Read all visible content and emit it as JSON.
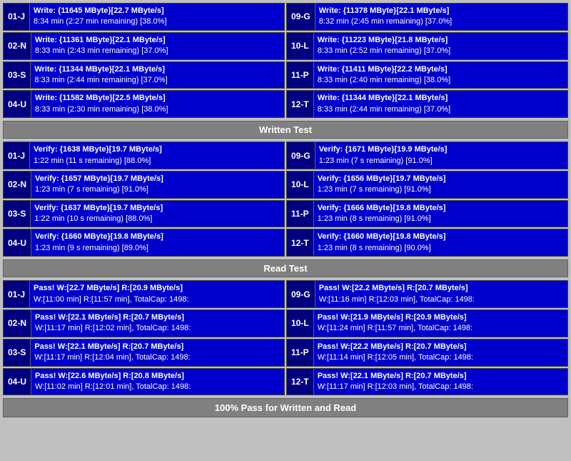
{
  "colors": {
    "bg": "#c0c0c0",
    "cell_bg": "#0000cd",
    "id_bg": "#000080",
    "header_bg": "#808080",
    "text_white": "#ffffff"
  },
  "written_test": {
    "header": "Written Test",
    "cells_left": [
      {
        "id": "01-J",
        "line1": "Write: {11645 MByte}[22.7 MByte/s]",
        "line2": "8:34 min (2:27 min remaining)  [38.0%]"
      },
      {
        "id": "02-N",
        "line1": "Write: {11361 MByte}[22.1 MByte/s]",
        "line2": "8:33 min (2:43 min remaining)  [37.0%]"
      },
      {
        "id": "03-S",
        "line1": "Write: {11344 MByte}[22.1 MByte/s]",
        "line2": "8:33 min (2:44 min remaining)  [37.0%]"
      },
      {
        "id": "04-U",
        "line1": "Write: {11582 MByte}[22.5 MByte/s]",
        "line2": "8:33 min (2:30 min remaining)  [38.0%]"
      }
    ],
    "cells_right": [
      {
        "id": "09-G",
        "line1": "Write: {11378 MByte}[22.1 MByte/s]",
        "line2": "8:32 min (2:45 min remaining)  [37.0%]"
      },
      {
        "id": "10-L",
        "line1": "Write: {11223 MByte}[21.8 MByte/s]",
        "line2": "8:33 min (2:52 min remaining)  [37.0%]"
      },
      {
        "id": "11-P",
        "line1": "Write: {11411 MByte}[22.2 MByte/s]",
        "line2": "8:33 min (2:40 min remaining)  [38.0%]"
      },
      {
        "id": "12-T",
        "line1": "Write: {11344 MByte}[22.1 MByte/s]",
        "line2": "8:33 min (2:44 min remaining)  [37.0%]"
      }
    ]
  },
  "verify_test": {
    "header": "Written Test",
    "cells_left": [
      {
        "id": "01-J",
        "line1": "Verify: {1638 MByte}[19.7 MByte/s]",
        "line2": "1:22 min (11 s remaining)   [88.0%]"
      },
      {
        "id": "02-N",
        "line1": "Verify: {1657 MByte}[19.7 MByte/s]",
        "line2": "1:23 min (7 s remaining)   [91.0%]"
      },
      {
        "id": "03-S",
        "line1": "Verify: {1637 MByte}[19.7 MByte/s]",
        "line2": "1:22 min (10 s remaining)   [88.0%]"
      },
      {
        "id": "04-U",
        "line1": "Verify: {1660 MByte}[19.8 MByte/s]",
        "line2": "1:23 min (9 s remaining)   [89.0%]"
      }
    ],
    "cells_right": [
      {
        "id": "09-G",
        "line1": "Verify: {1671 MByte}[19.9 MByte/s]",
        "line2": "1:23 min (7 s remaining)   [91.0%]"
      },
      {
        "id": "10-L",
        "line1": "Verify: {1656 MByte}[19.7 MByte/s]",
        "line2": "1:23 min (7 s remaining)   [91.0%]"
      },
      {
        "id": "11-P",
        "line1": "Verify: {1666 MByte}[19.8 MByte/s]",
        "line2": "1:23 min (8 s remaining)   [91.0%]"
      },
      {
        "id": "12-T",
        "line1": "Verify: {1660 MByte}[19.8 MByte/s]",
        "line2": "1:23 min (8 s remaining)   [90.0%]"
      }
    ]
  },
  "read_test": {
    "header": "Read Test",
    "cells_left": [
      {
        "id": "01-J",
        "line1": "Pass! W:[22.7 MByte/s] R:[20.9 MByte/s]",
        "line2": " W:[11:00 min] R:[11:57 min], TotalCap: 1498:"
      },
      {
        "id": "02-N",
        "line1": "Pass! W:[22.1 MByte/s] R:[20.7 MByte/s]",
        "line2": " W:[11:17 min] R:[12:02 min], TotalCap: 1498:"
      },
      {
        "id": "03-S",
        "line1": "Pass! W:[22.1 MByte/s] R:[20.7 MByte/s]",
        "line2": " W:[11:17 min] R:[12:04 min], TotalCap: 1498:"
      },
      {
        "id": "04-U",
        "line1": "Pass! W:[22.6 MByte/s] R:[20.8 MByte/s]",
        "line2": " W:[11:02 min] R:[12:01 min], TotalCap: 1498:"
      }
    ],
    "cells_right": [
      {
        "id": "09-G",
        "line1": "Pass! W:[22.2 MByte/s] R:[20.7 MByte/s]",
        "line2": " W:[11:16 min] R:[12:03 min], TotalCap: 1498:"
      },
      {
        "id": "10-L",
        "line1": "Pass! W:[21.9 MByte/s] R:[20.9 MByte/s]",
        "line2": " W:[11:24 min] R:[11:57 min], TotalCap: 1498:"
      },
      {
        "id": "11-P",
        "line1": "Pass! W:[22.2 MByte/s] R:[20.7 MByte/s]",
        "line2": " W:[11:14 min] R:[12:05 min], TotalCap: 1498:"
      },
      {
        "id": "12-T",
        "line1": "Pass! W:[22.1 MByte/s] R:[20.7 MByte/s]",
        "line2": " W:[11:17 min] R:[12:03 min], TotalCap: 1498:"
      }
    ]
  },
  "footer": "100% Pass for Written and Read"
}
